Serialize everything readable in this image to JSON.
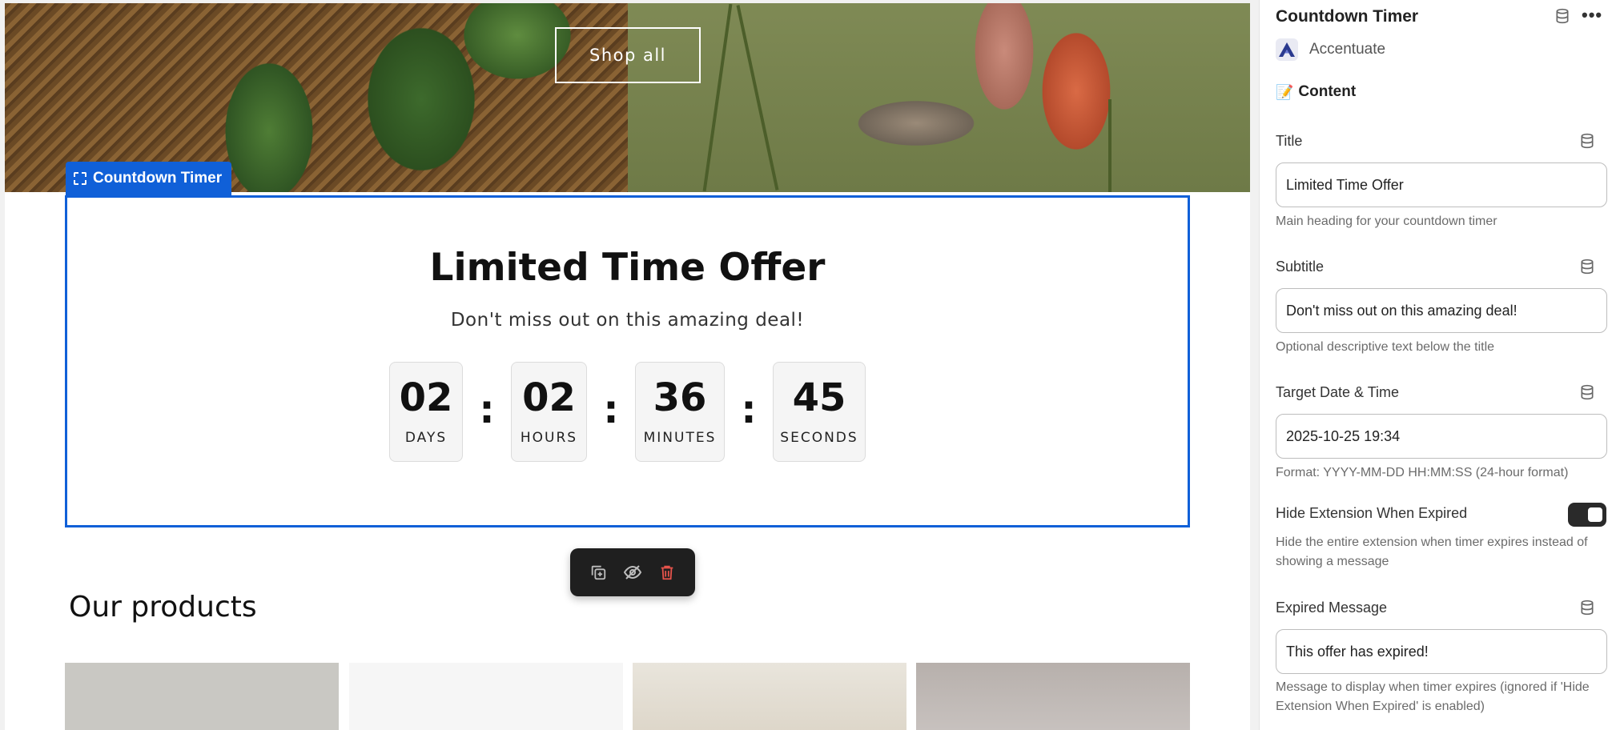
{
  "hero": {
    "shop_all_label": "Shop all"
  },
  "block_tag": {
    "label": "Countdown Timer"
  },
  "countdown": {
    "title": "Limited Time Offer",
    "subtitle": "Don't miss out on this amazing deal!",
    "units": [
      {
        "value": "02",
        "label": "DAYS"
      },
      {
        "value": "02",
        "label": "HOURS"
      },
      {
        "value": "36",
        "label": "MINUTES"
      },
      {
        "value": "45",
        "label": "SECONDS"
      }
    ],
    "separator": ":"
  },
  "toolbar": {
    "icons": [
      "duplicate-icon",
      "hide-icon",
      "delete-icon"
    ]
  },
  "products": {
    "heading": "Our products"
  },
  "panel": {
    "title": "Countdown Timer",
    "app_name": "Accentuate",
    "section_heading": "Content",
    "section_icon": "📝",
    "fields": {
      "title": {
        "label": "Title",
        "value": "Limited Time Offer",
        "help": "Main heading for your countdown timer"
      },
      "subtitle": {
        "label": "Subtitle",
        "value": "Don't miss out on this amazing deal!",
        "help": "Optional descriptive text below the title"
      },
      "target": {
        "label": "Target Date & Time",
        "value": "2025-10-25 19:34",
        "help": "Format: YYYY-MM-DD HH:MM:SS (24-hour format)"
      },
      "hide_expired": {
        "label": "Hide Extension When Expired",
        "help": "Hide the entire extension when timer expires instead of showing a message",
        "enabled": true
      },
      "expired_message": {
        "label": "Expired Message",
        "value": "This offer has expired!",
        "help": "Message to display when timer expires (ignored if 'Hide Extension When Expired' is enabled)"
      }
    }
  },
  "colors": {
    "accent": "#1060d8",
    "toolbar_bg": "#1f1f1f",
    "delete": "#e5534b"
  }
}
